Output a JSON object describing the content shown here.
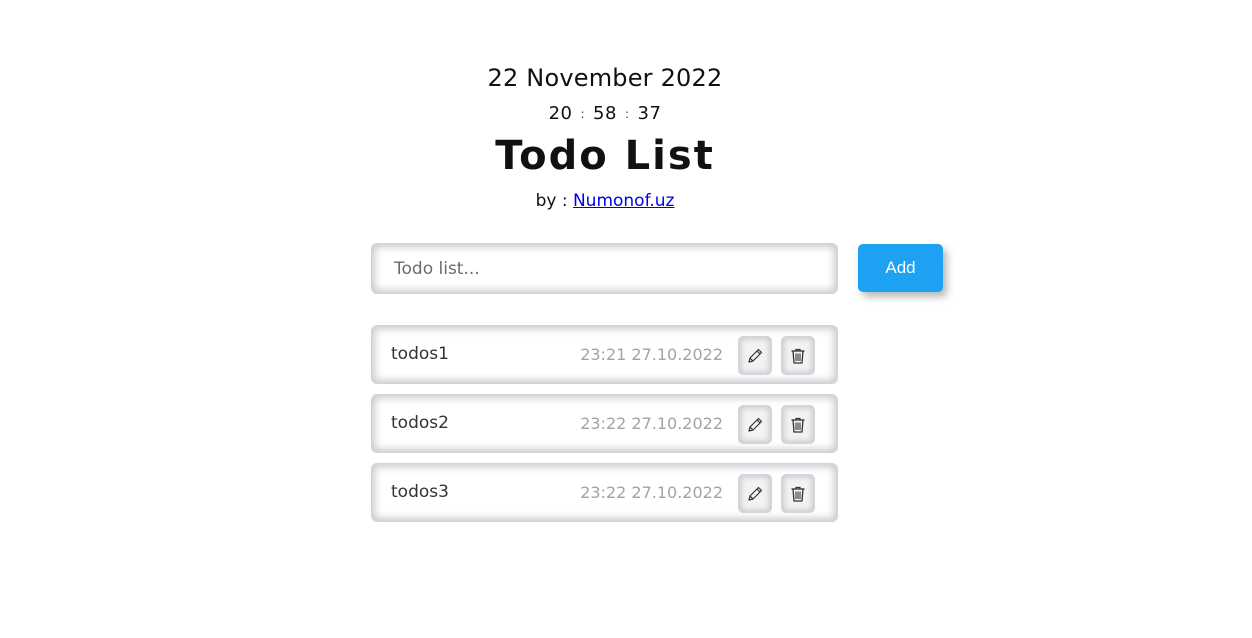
{
  "header": {
    "date": "22 November 2022",
    "clock": {
      "hours": "20",
      "minutes": "58",
      "seconds": "37",
      "separator": ":"
    },
    "title": "Todo List",
    "byline_prefix": "by :",
    "author_link": "Numonof.uz"
  },
  "form": {
    "input_value": "",
    "input_placeholder": "Todo list...",
    "add_label": "Add"
  },
  "todos": [
    {
      "text": "todos1",
      "time": "23:21 27.10.2022"
    },
    {
      "text": "todos2",
      "time": "23:22 27.10.2022"
    },
    {
      "text": "todos3",
      "time": "23:22 27.10.2022"
    }
  ],
  "icons": {
    "edit": "pencil-icon",
    "delete": "trash-icon"
  },
  "colors": {
    "accent": "#1da1f2",
    "link": "#0000ee",
    "muted_text": "#a3a3a3"
  }
}
